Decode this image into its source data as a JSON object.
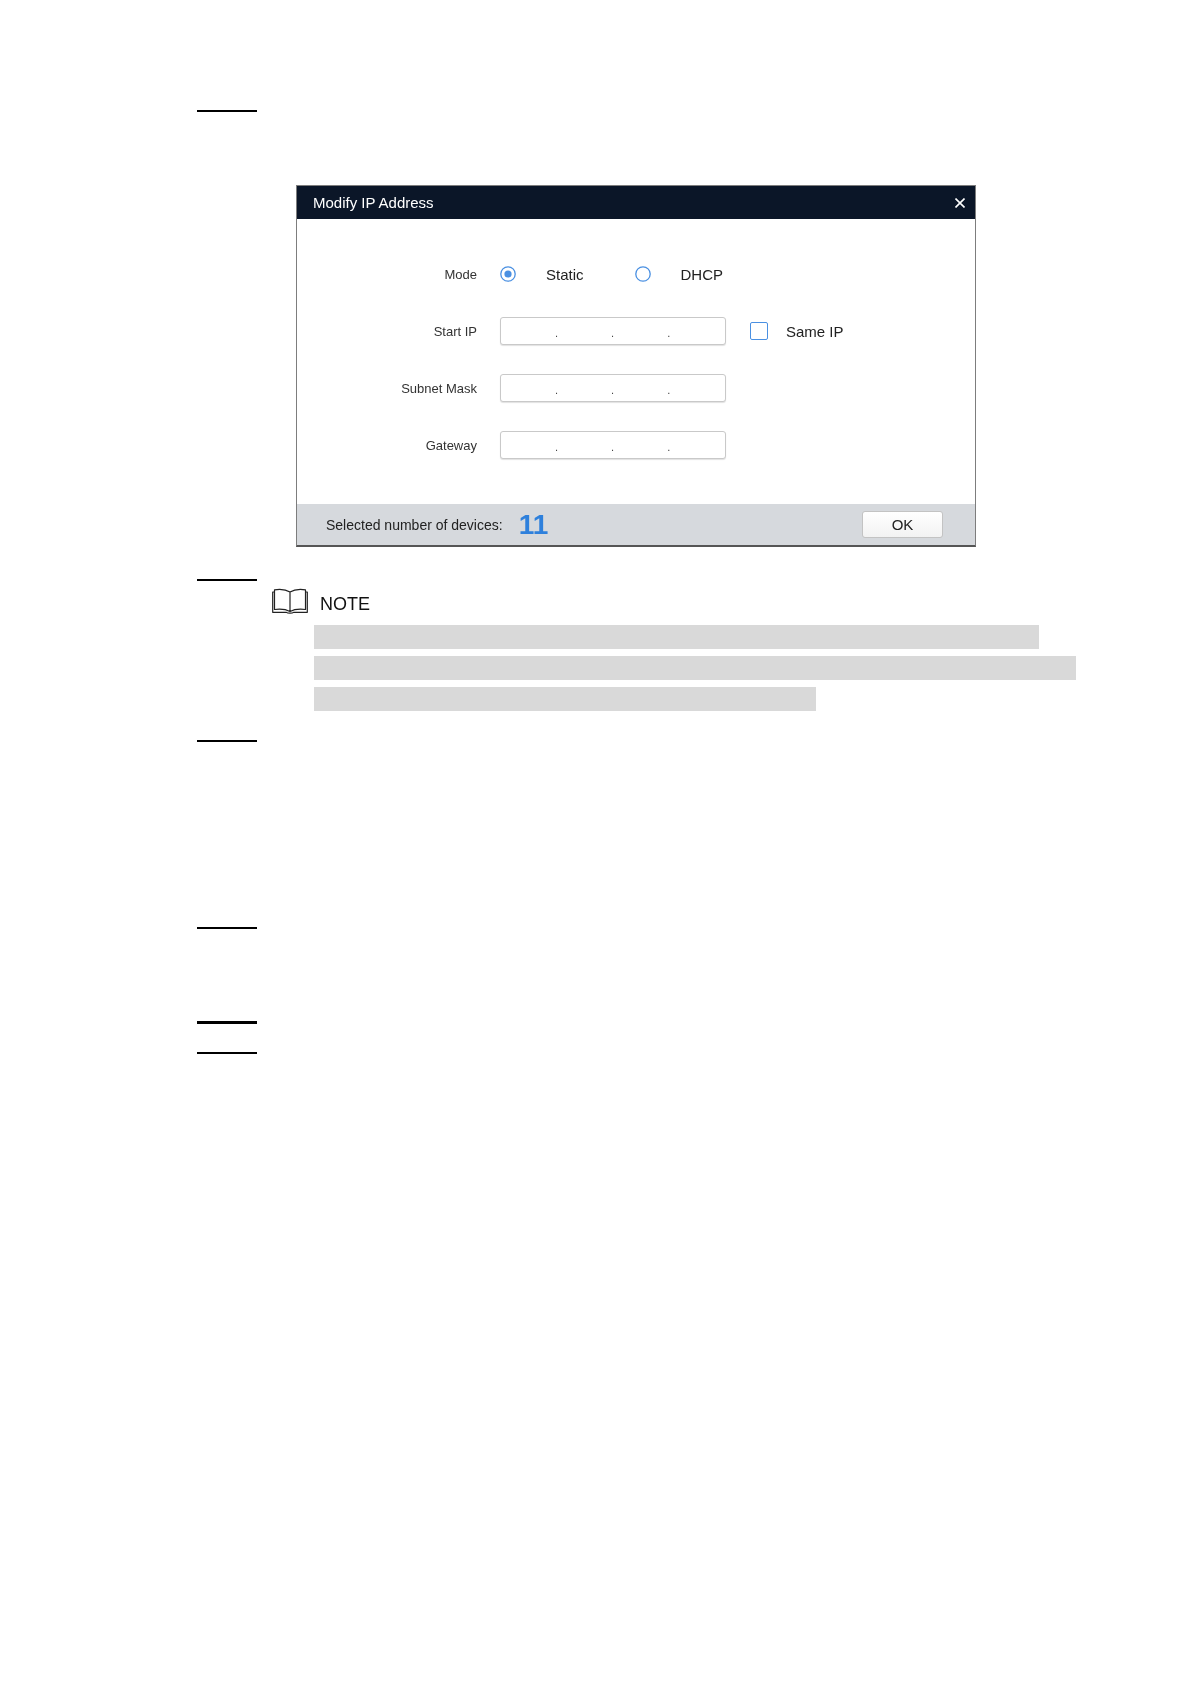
{
  "dialog": {
    "title": "Modify IP Address",
    "mode": {
      "label": "Mode",
      "options": [
        {
          "label": "Static",
          "selected": true
        },
        {
          "label": "DHCP",
          "selected": false
        }
      ]
    },
    "fields": [
      {
        "label": "Start IP",
        "separators": [
          ".",
          ".",
          "."
        ],
        "same_ip": {
          "label": "Same IP",
          "checked": false
        }
      },
      {
        "label": "Subnet Mask",
        "separators": [
          ".",
          ".",
          "."
        ]
      },
      {
        "label": "Gateway",
        "separators": [
          ".",
          ".",
          "."
        ]
      }
    ],
    "footer": {
      "label": "Selected number of devices:",
      "count": "11",
      "button": "OK"
    }
  },
  "note": {
    "title": "NOTE"
  }
}
